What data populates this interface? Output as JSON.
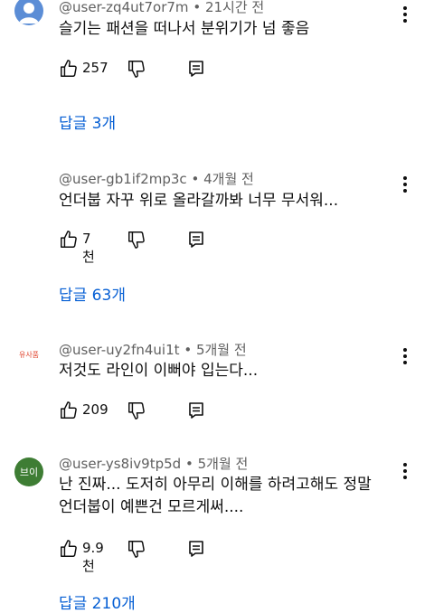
{
  "comments": [
    {
      "author": "@user-zq4ut7or7m",
      "time": "21시간 전",
      "lines": [
        "슬기는 패션을 떠나서 분위기가 넘 좋음"
      ],
      "likes": "257",
      "replies": "답글 3개"
    },
    {
      "author": "@user-gb1if2mp3c",
      "time": "4개월 전",
      "lines": [
        "언더붑 자꾸 위로 올라갈까봐 너무 무서워..."
      ],
      "likes": "7천",
      "replies": "답글 63개"
    },
    {
      "author": "@user-uy2fn4ui1t",
      "time": "5개월 전",
      "lines": [
        "저것도 라인이 이뻐야 입는다..."
      ],
      "likes": "209",
      "avatar_text": "유사품"
    },
    {
      "author": "@user-ys8iv9tp5d",
      "time": "5개월 전",
      "lines": [
        "난 진짜... 도저히 아무리 이해를 하려고해도 정말",
        "언더붑이 예쁜건 모르게써...."
      ],
      "likes": "9.9천",
      "replies": "답글 210개",
      "avatar_text": "브이"
    }
  ],
  "separator": "•",
  "colors": {
    "link": "#065fd4",
    "meta": "#606060",
    "avatar_green": "#3e7d34",
    "avatar_blue": "#5b8dd6",
    "avatar_red_text": "#e0412a"
  },
  "icons": [
    "more-vert-icon",
    "thumb-up-icon",
    "thumb-down-icon",
    "reply-icon"
  ]
}
